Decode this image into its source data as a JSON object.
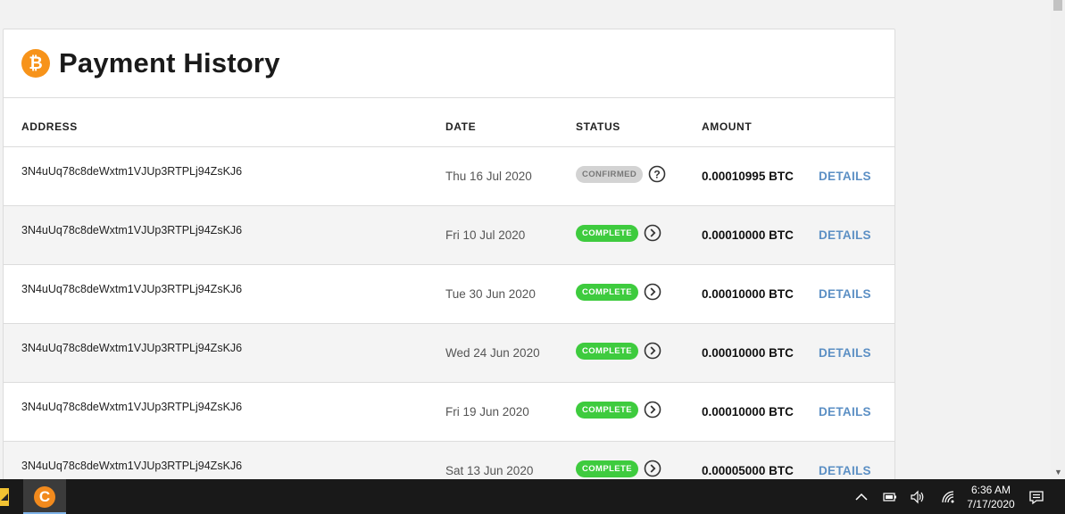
{
  "header": {
    "title": "Payment History",
    "icon": "bitcoin-icon",
    "icon_glyph": "₿"
  },
  "columns": {
    "address": "ADDRESS",
    "date": "DATE",
    "status": "STATUS",
    "amount": "AMOUNT"
  },
  "rows": [
    {
      "address": "3N4uUq78c8deWxtm1VJUp3RTPLj94ZsKJ6",
      "date": "Thu 16 Jul 2020",
      "status": "CONFIRMED",
      "status_icon": "question-circle-icon",
      "amount": "0.00010995 BTC",
      "action": "DETAILS"
    },
    {
      "address": "3N4uUq78c8deWxtm1VJUp3RTPLj94ZsKJ6",
      "date": "Fri 10 Jul 2020",
      "status": "COMPLETE",
      "status_icon": "chevron-right-circle-icon",
      "amount": "0.00010000 BTC",
      "action": "DETAILS"
    },
    {
      "address": "3N4uUq78c8deWxtm1VJUp3RTPLj94ZsKJ6",
      "date": "Tue 30 Jun 2020",
      "status": "COMPLETE",
      "status_icon": "chevron-right-circle-icon",
      "amount": "0.00010000 BTC",
      "action": "DETAILS"
    },
    {
      "address": "3N4uUq78c8deWxtm1VJUp3RTPLj94ZsKJ6",
      "date": "Wed 24 Jun 2020",
      "status": "COMPLETE",
      "status_icon": "chevron-right-circle-icon",
      "amount": "0.00010000 BTC",
      "action": "DETAILS"
    },
    {
      "address": "3N4uUq78c8deWxtm1VJUp3RTPLj94ZsKJ6",
      "date": "Fri 19 Jun 2020",
      "status": "COMPLETE",
      "status_icon": "chevron-right-circle-icon",
      "amount": "0.00010000 BTC",
      "action": "DETAILS"
    },
    {
      "address": "3N4uUq78c8deWxtm1VJUp3RTPLj94ZsKJ6",
      "date": "Sat 13 Jun 2020",
      "status": "COMPLETE",
      "status_icon": "chevron-right-circle-icon",
      "amount": "0.00005000 BTC",
      "action": "DETAILS"
    }
  ],
  "colors": {
    "complete": "#3ecb3e",
    "confirmed": "#d3d3d3",
    "details_link": "#5b8fc4",
    "bitcoin": "#f7931a"
  },
  "taskbar": {
    "app_icon": "app-c-icon",
    "app_glyph": "C",
    "tray_icons": [
      "chevron-up-icon",
      "battery-icon",
      "volume-icon",
      "wifi-icon",
      "notification-icon"
    ],
    "time": "6:36 AM",
    "date": "7/17/2020"
  }
}
